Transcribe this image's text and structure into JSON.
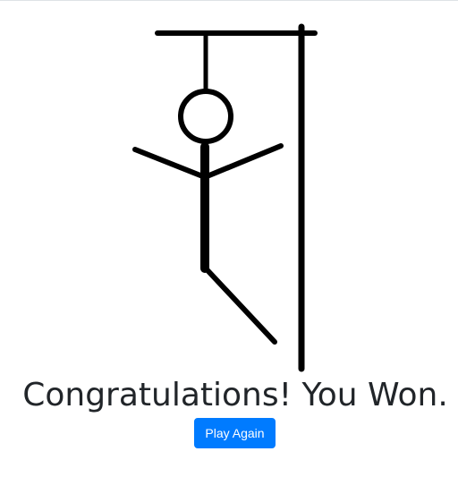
{
  "game": {
    "status_message": "Congratulations! You Won.",
    "play_again_label": "Play Again"
  },
  "colors": {
    "ink": "#000000",
    "text": "#212529",
    "button_bg": "#007bff",
    "button_text": "#ffffff"
  }
}
